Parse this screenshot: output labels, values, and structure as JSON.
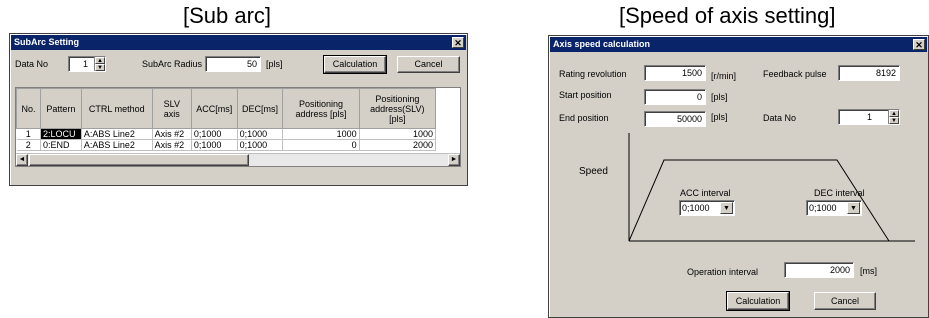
{
  "sub_arc": {
    "caption": "[Sub arc]",
    "title": "SubArc Setting",
    "close_glyph": "✕",
    "data_no_label": "Data No",
    "data_no_value": "1",
    "radius_label": "SubArc Radius",
    "radius_value": "50",
    "radius_unit": "[pls]",
    "calculation_label": "Calculation",
    "cancel_label": "Cancel",
    "columns": [
      "No.",
      "Pattern",
      "CTRL method",
      "SLV axis",
      "ACC[ms]",
      "DEC[ms]",
      "Positioning address [pls]",
      "Positioning address(SLV) [pls]"
    ],
    "rows": [
      [
        "1",
        "2:LOCU",
        "A:ABS Line2",
        "Axis #2",
        "0;1000",
        "0;1000",
        "1000",
        "1000"
      ],
      [
        "2",
        "0:END",
        "A:ABS Line2",
        "Axis #2",
        "0;1000",
        "0;1000",
        "0",
        "2000"
      ]
    ],
    "scroll_left": "◄",
    "scroll_right": "►"
  },
  "speed": {
    "caption": "[Speed of axis setting]",
    "title": "Axis speed calculation",
    "close_glyph": "✕",
    "rating_label": "Rating revolution",
    "rating_value": "1500",
    "rating_unit": "[r/min]",
    "feedback_label": "Feedback pulse",
    "feedback_value": "8192",
    "start_label": "Start position",
    "start_value": "0",
    "start_unit": "[pls]",
    "end_label": "End position",
    "end_value": "50000",
    "end_unit": "[pls]",
    "data_no_label": "Data No",
    "data_no_value": "1",
    "speed_label": "Speed",
    "acc_label": "ACC interval",
    "acc_value": "0;1000",
    "dec_label": "DEC interval",
    "dec_value": "0;1000",
    "op_label": "Operation interval",
    "op_value": "2000",
    "op_unit": "[ms]",
    "calculation_label": "Calculation",
    "cancel_label": "Cancel"
  }
}
